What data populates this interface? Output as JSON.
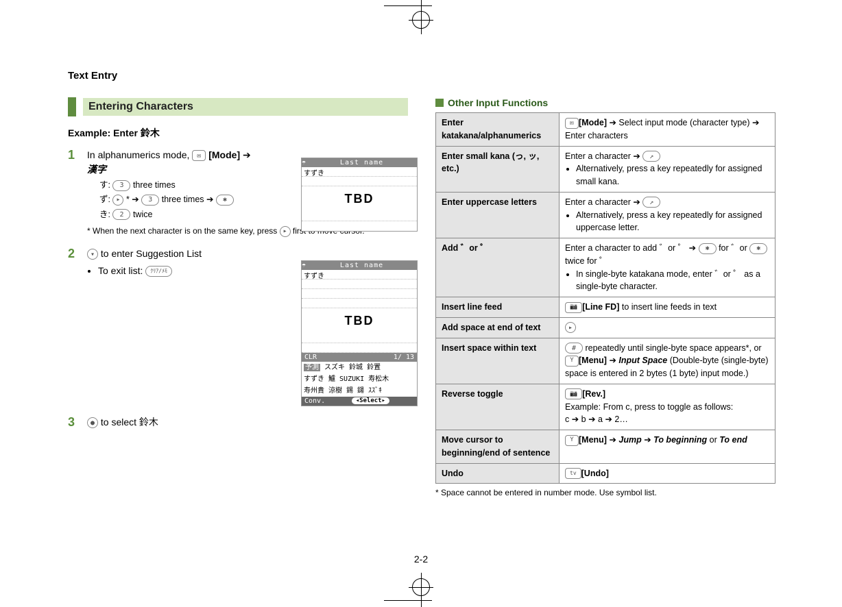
{
  "header": {
    "title": "Text Entry"
  },
  "section": {
    "title": "Entering Characters"
  },
  "example": {
    "label": "Example: Enter 鈴木"
  },
  "steps": {
    "s1": {
      "num": "1",
      "text_a": "In alphanumerics mode, ",
      "mode_label": "[Mode]",
      "arrow": " ➔ ",
      "kanji": "漢字",
      "sub_su_prefix": "す: ",
      "sub_su_suffix": " three times",
      "sub_zu_prefix": "ず: ",
      "sub_zu_mid": "* ➔ ",
      "sub_zu_suffix": " three times ➔ ",
      "sub_ki_prefix": "き: ",
      "sub_ki_suffix": " twice",
      "note": "* When the next character is on the same key, press ",
      "note_suffix": " first to move cursor."
    },
    "s2": {
      "num": "2",
      "text": " to enter Suggestion List",
      "bullet": "To exit list: "
    },
    "s3": {
      "num": "3",
      "text": " to select 鈴木"
    }
  },
  "screenshot1": {
    "title": "Last name",
    "line1": "すずき",
    "tbd": "TBD"
  },
  "screenshot2": {
    "title": "Last name",
    "line1": "すずき",
    "tbd": "TBD",
    "clr": "CLR",
    "counter": "1/ 13",
    "sugg1": "スズキ  鈴城  鈴置",
    "sugg2": "すずき  鱸  SUZUKI  寿松木",
    "sugg3": "寿州貴  涼樹  錫  鐋  ｽｽﾞｷ",
    "conv": "Conv.",
    "select": "Select"
  },
  "right": {
    "heading": "Other Input Functions",
    "rows": {
      "r1l": "Enter katakana/alphanumerics",
      "r1r_a": "[Mode]",
      "r1r_b": " ➔ Select input mode (character type) ➔ Enter characters",
      "r2l": "Enter small kana (っ, ッ, etc.)",
      "r2r_a": "Enter a character ➔ ",
      "r2r_b": "Alternatively, press a key repeatedly for assigned small kana.",
      "r3l": "Enter uppercase letters",
      "r3r_a": "Enter a character ➔ ",
      "r3r_b": "Alternatively, press a key repeatedly for assigned uppercase letter.",
      "r4l": "Add ゛or ゜",
      "r4r_a": "Enter a character to add ゛or ゜ ➔ ",
      "r4r_b": " for ゛or ",
      "r4r_c": " twice for ゜",
      "r4r_d": "In single-byte katakana mode, enter ゛or ゜ as a single-byte character.",
      "r5l": "Insert line feed",
      "r5r_a": "[Line FD]",
      "r5r_b": " to insert line feeds in text",
      "r6l": "Add space at end of text",
      "r7l": "Insert space within text",
      "r7r_a": " repeatedly until single-byte space appears*, or ",
      "r7r_b": "[Menu]",
      "r7r_c": " ➔ ",
      "r7r_d": "Input Space",
      "r7r_e": " (Double-byte (single-byte) space is entered in 2 bytes (1 byte) input mode.)",
      "r8l": "Reverse toggle",
      "r8r_a": "[Rev.]",
      "r8r_b": "Example: From c, press to toggle as follows:",
      "r8r_c": "c ➔ b ➔ a ➔ 2…",
      "r9l": "Move cursor to beginning/end of sentence",
      "r9r_a": "[Menu]",
      "r9r_b": " ➔ ",
      "r9r_c": "Jump",
      "r9r_d": " ➔ ",
      "r9r_e": "To beginning",
      "r9r_f": " or ",
      "r9r_g": "To end",
      "r10l": "Undo",
      "r10r": "[Undo]"
    },
    "footnote": "* Space cannot be entered in number mode. Use symbol list."
  },
  "keys": {
    "k3": "3",
    "k2": "2",
    "kstar": "✱",
    "khash": "#",
    "kright": "▸",
    "kdown": "▾",
    "kcenter": "●",
    "kclear": "ｸﾘｱ/ﾒﾓ",
    "kcall": "↗"
  },
  "page_num": "2-2"
}
